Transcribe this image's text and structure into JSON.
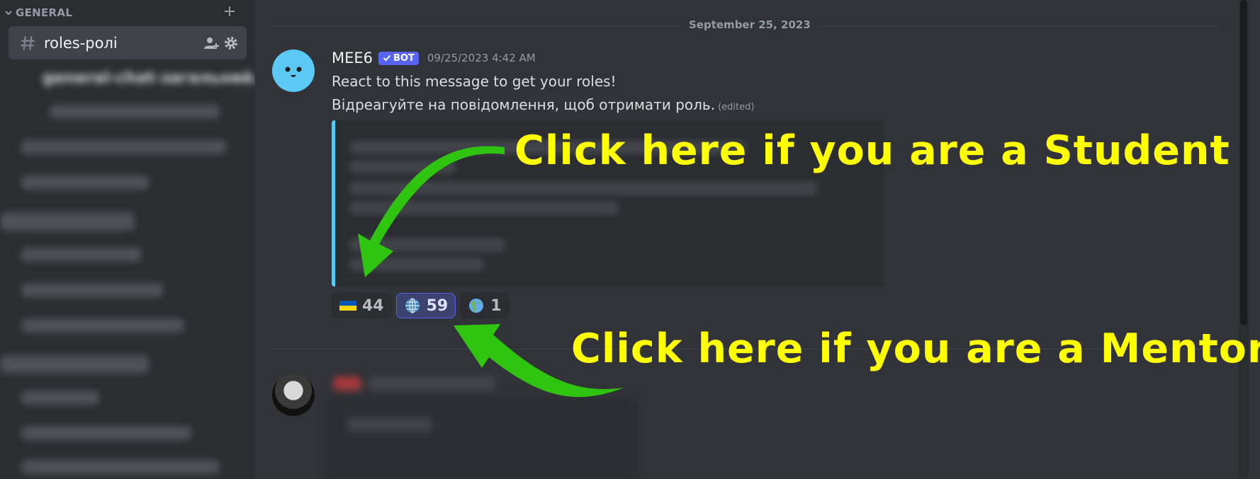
{
  "sidebar": {
    "category_label": "GENERAL",
    "active_channel": {
      "name": "roles-ролі"
    },
    "blurred_channel": "general-chat-загальний..."
  },
  "chat": {
    "date_divider": "September 25, 2023",
    "message": {
      "author": "MEE6",
      "bot_badge": "BOT",
      "timestamp": "09/25/2023 4:42 AM",
      "line1": "React to this message to get your roles!",
      "line2": "Відреагуйте на повідомлення, щоб отримати роль.",
      "edited": "(edited)",
      "reactions": [
        {
          "emoji": "ukraine-flag-icon",
          "count": "44",
          "selected": false
        },
        {
          "emoji": "globe-meridians-icon",
          "count": "59",
          "selected": true
        },
        {
          "emoji": "earth-americas-icon",
          "count": "1",
          "selected": false
        }
      ]
    }
  },
  "annotations": {
    "student": "Click here if you are a Student",
    "mentor": "Click here if you are a Mentor",
    "text_color": "#ffff00",
    "arrow_color": "#2ec40f"
  }
}
